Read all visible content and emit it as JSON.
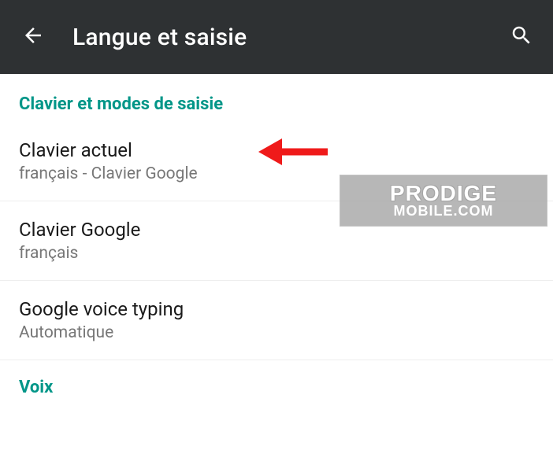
{
  "colors": {
    "appbar_bg": "#2e3133",
    "accent": "#009688",
    "text_primary": "#1a1a1a",
    "text_secondary": "#777777",
    "annotation_red": "#ef1a1a"
  },
  "header": {
    "title": "Langue et saisie"
  },
  "sections": [
    {
      "id": "keyboard",
      "header": "Clavier et modes de saisie",
      "items": [
        {
          "id": "current-keyboard",
          "title": "Clavier actuel",
          "subtitle": "français - Clavier Google",
          "annotated": true
        },
        {
          "id": "google-keyboard",
          "title": "Clavier Google",
          "subtitle": "français"
        },
        {
          "id": "google-voice-typing",
          "title": "Google voice typing",
          "subtitle": "Automatique"
        }
      ]
    },
    {
      "id": "voice",
      "header": "Voix",
      "items": []
    }
  ],
  "watermark": {
    "line1": "PRODIGE",
    "line2": "MOBILE.COM"
  }
}
